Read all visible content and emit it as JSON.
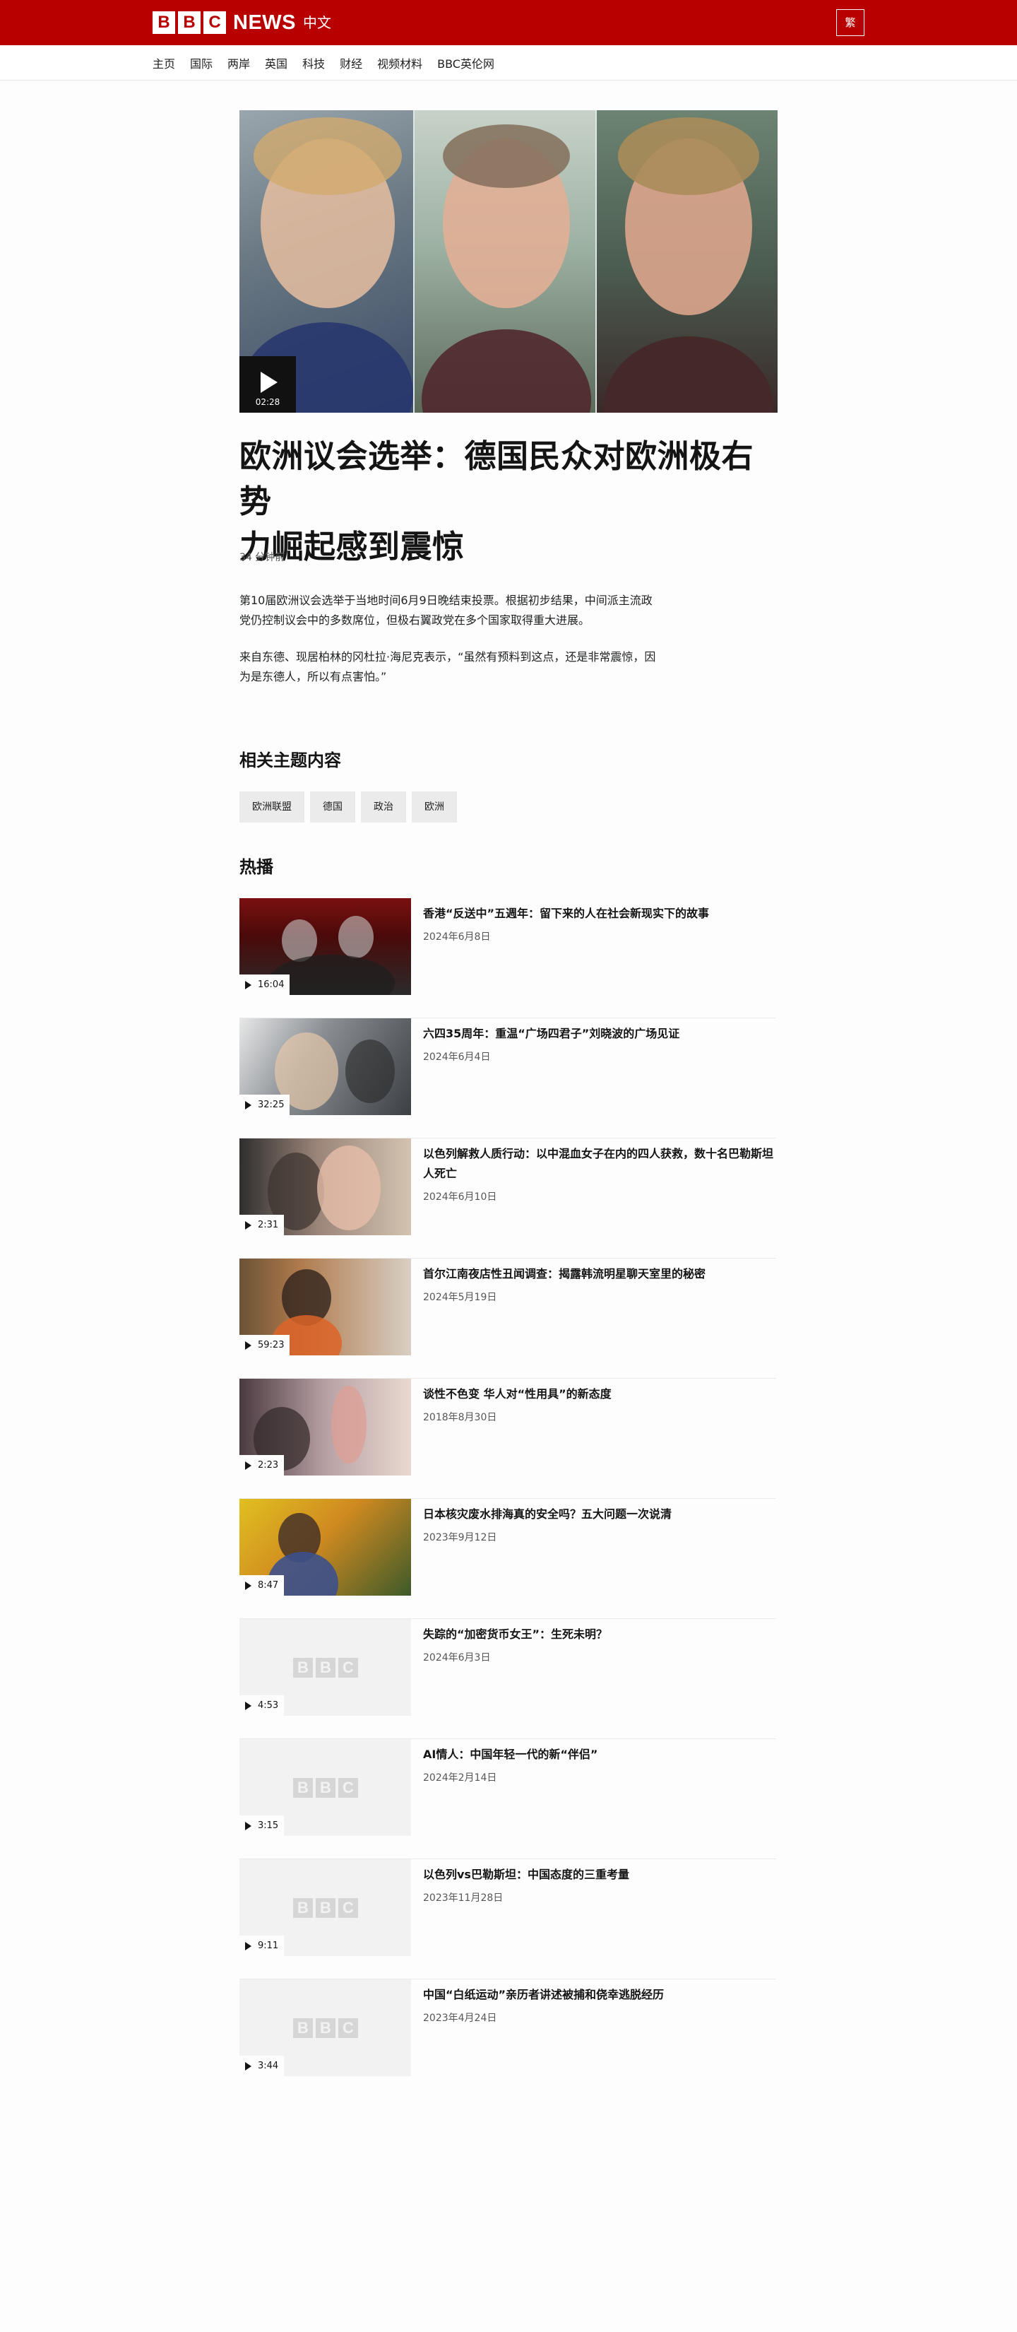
{
  "header": {
    "logo_letters": [
      "B",
      "B",
      "C"
    ],
    "logo_news": "NEWS",
    "logo_sub": "中文",
    "lang_toggle": "繁",
    "brand_color": "#b80000"
  },
  "nav": [
    "主页",
    "国际",
    "两岸",
    "英国",
    "科技",
    "财经",
    "视频材料",
    "BBC英伦网"
  ],
  "hero": {
    "duration": "02:28",
    "icon": "play-icon"
  },
  "article": {
    "headline_line1": "欧洲议会选举：德国民众对欧洲极右势",
    "headline_line2": "力崛起感到震惊",
    "timestamp": "34 分钟前",
    "para1_line1": "第10届欧洲议会选举于当地时间6月9日晚结束投票。根据初步结果，中间派主流政",
    "para1_line2": "党仍控制议会中的多数席位，但极右翼政党在多个国家取得重大进展。",
    "para2_line1": "来自东德、现居柏林的冈杜拉·海尼克表示，“虽然有预料到这点，还是非常震惊，因",
    "para2_line2": "为是东德人，所以有点害怕。”"
  },
  "related": {
    "heading": "相关主题内容",
    "tags": [
      "欧洲联盟",
      "德国",
      "政治",
      "欧洲"
    ]
  },
  "popular": {
    "heading": "热播",
    "items": [
      {
        "title": "香港“反送中”五週年：留下来的人在社会新现实下的故事",
        "date": "2024年6月8日",
        "duration": "16:04"
      },
      {
        "title": "六四35周年：重温“广场四君子”刘晓波的广场见证",
        "date": "2024年6月4日",
        "duration": "32:25"
      },
      {
        "title_line1": "以色列解救人质行动：以中混血女子在内的四人获救，数十名巴勒斯坦",
        "title_line2": "人死亡",
        "date": "2024年6月10日",
        "duration": "2:31"
      },
      {
        "title": "首尔江南夜店性丑闻调查：揭露韩流明星聊天室里的秘密",
        "date": "2024年5月19日",
        "duration": "59:23"
      },
      {
        "title": "谈性不色变 华人对“性用具”的新态度",
        "date": "2018年8月30日",
        "duration": "2:23"
      },
      {
        "title": "日本核灾废水排海真的安全吗？五大问题一次说清",
        "date": "2023年9月12日",
        "duration": "8:47"
      },
      {
        "title": "失踪的“加密货币女王”：生死未明？",
        "date": "2024年6月3日",
        "duration": "4:53"
      },
      {
        "title": "AI情人：中国年轻一代的新“伴侣”",
        "date": "2024年2月14日",
        "duration": "3:15"
      },
      {
        "title": "以色列vs巴勒斯坦：中国态度的三重考量",
        "date": "2023年11月28日",
        "duration": "9:11"
      },
      {
        "title": "中国“白纸运动”亲历者讲述被捕和侥幸逃脱经历",
        "date": "2023年4月24日",
        "duration": "3:44"
      }
    ]
  }
}
